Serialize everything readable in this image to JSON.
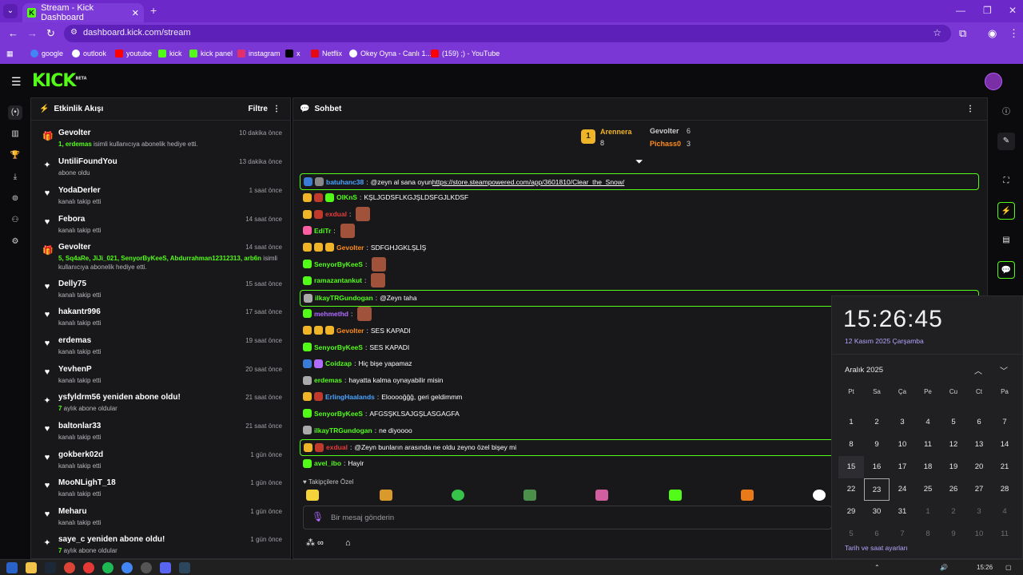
{
  "browser": {
    "tab_title": "Stream - Kick Dashboard",
    "url": "dashboard.kick.com/stream",
    "bookmarks": [
      {
        "label": "google",
        "color": "#4285f4"
      },
      {
        "label": "outlook",
        "color": "#ffffff"
      },
      {
        "label": "youtube",
        "color": "#ff0000"
      },
      {
        "label": "kick",
        "color": "#53fc18"
      },
      {
        "label": "kick panel",
        "color": "#53fc18"
      },
      {
        "label": "instagram",
        "color": "#e1306c"
      },
      {
        "label": "x",
        "color": "#000000"
      },
      {
        "label": "Netflix",
        "color": "#e50914"
      },
      {
        "label": "Okey Oyna - Canlı 1...",
        "color": "#ffffff"
      },
      {
        "label": "(159) ;) - YouTube",
        "color": "#ff0000"
      }
    ]
  },
  "header": {
    "logo": "KICK",
    "beta": "BETA"
  },
  "activity": {
    "title": "Etkinlik Akışı",
    "filter": "Filtre",
    "events": [
      {
        "icon": "gift-icon",
        "name": "Gevolter",
        "time": "10 dakika önce",
        "desc_hl": "1, erdemas",
        "desc": " isimli kullanıcıya abonelik hediye etti.",
        "color": "#53fc18"
      },
      {
        "icon": "sparkle-icon",
        "name": "UntiliFoundYou",
        "time": "13 dakika önce",
        "desc_hl": "",
        "desc": "abone oldu",
        "color": "#ffffff"
      },
      {
        "icon": "heart-icon",
        "name": "YodaDerler",
        "time": "1 saat önce",
        "desc_hl": "",
        "desc": "kanalı takip etti",
        "color": "#ffffff"
      },
      {
        "icon": "heart-icon",
        "name": "Febora",
        "time": "14 saat önce",
        "desc_hl": "",
        "desc": "kanalı takip etti",
        "color": "#ffffff"
      },
      {
        "icon": "gift-icon",
        "name": "Gevolter",
        "time": "14 saat önce",
        "desc_hl": "5, Sq4aRe, JiJi_021, SenyorByKeeS, Abdurrahman12312313, arb6n",
        "desc": " isimli kullanıcıya abonelik hediye etti.",
        "color": "#53fc18"
      },
      {
        "icon": "heart-icon",
        "name": "Delly75",
        "time": "15 saat önce",
        "desc_hl": "",
        "desc": "kanalı takip etti",
        "color": "#ffffff"
      },
      {
        "icon": "heart-icon",
        "name": "hakantr996",
        "time": "17 saat önce",
        "desc_hl": "",
        "desc": "kanalı takip etti",
        "color": "#ffffff"
      },
      {
        "icon": "heart-icon",
        "name": "erdemas",
        "time": "19 saat önce",
        "desc_hl": "",
        "desc": "kanalı takip etti",
        "color": "#ffffff"
      },
      {
        "icon": "heart-icon",
        "name": "YevhenP",
        "time": "20 saat önce",
        "desc_hl": "",
        "desc": "kanalı takip etti",
        "color": "#ffffff"
      },
      {
        "icon": "sparkle-icon",
        "name": "ysfyldrm56 yeniden abone oldu!",
        "time": "21 saat önce",
        "desc_hl": "7",
        "desc": " aylık abone oldular",
        "color": "#ffffff"
      },
      {
        "icon": "heart-icon",
        "name": "baltonlar33",
        "time": "21 saat önce",
        "desc_hl": "",
        "desc": "kanalı takip etti",
        "color": "#ffffff"
      },
      {
        "icon": "heart-icon",
        "name": "gokberk02d",
        "time": "1 gün önce",
        "desc_hl": "",
        "desc": "kanalı takip etti",
        "color": "#ffffff"
      },
      {
        "icon": "heart-icon",
        "name": "MooNLighT_18",
        "time": "1 gün önce",
        "desc_hl": "",
        "desc": "kanalı takip etti",
        "color": "#ffffff"
      },
      {
        "icon": "heart-icon",
        "name": "Meharu",
        "time": "1 gün önce",
        "desc_hl": "",
        "desc": "kanalı takip etti",
        "color": "#ffffff"
      },
      {
        "icon": "sparkle-icon",
        "name": "saye_c yeniden abone oldu!",
        "time": "1 gün önce",
        "desc_hl": "7",
        "desc": " aylık abone oldular",
        "color": "#ffffff"
      }
    ]
  },
  "chat": {
    "title": "Sohbet",
    "podium": {
      "first": "Arennera",
      "first_count": "8",
      "second": "Gevolter",
      "second_count": "6",
      "third": "Pichass0",
      "third_count": "3",
      "first_rank": "1"
    },
    "messages": [
      {
        "user": "batuhanc38",
        "color": "#4aa3ff",
        "text": "@zeyn al sana oyun ",
        "link": "https://store.steampowered.com/app/3601810/Clear_the_Snow/",
        "hl": true,
        "badges": [
          "#3a7bd5",
          "#888"
        ],
        "emote": false
      },
      {
        "user": "OlKnS",
        "color": "#53fc18",
        "text": "KŞLJGDSFLKGJŞLDSFGJLKDSF",
        "hl": false,
        "badges": [
          "#f0b429",
          "#c0392b",
          "#53fc18"
        ],
        "emote": false
      },
      {
        "user": "exdual",
        "color": "#e83b3b",
        "text": "",
        "hl": false,
        "badges": [
          "#f0b429",
          "#c0392b"
        ],
        "emote": true
      },
      {
        "user": "EdiTr",
        "color": "#53fc18",
        "text": "",
        "hl": false,
        "badges": [
          "#ff5fa2"
        ],
        "emote": true
      },
      {
        "user": "Gevolter",
        "color": "#ff8c1a",
        "text": "SDFGHJGKLŞLİŞ",
        "hl": false,
        "badges": [
          "#f0b429",
          "#f0b429",
          "#f0b429"
        ],
        "emote": false
      },
      {
        "user": "SenyorByKeeS",
        "color": "#53fc18",
        "text": "",
        "hl": false,
        "badges": [
          "#53fc18"
        ],
        "emote": true
      },
      {
        "user": "ramazantankut",
        "color": "#53fc18",
        "text": "",
        "hl": false,
        "badges": [
          "#53fc18"
        ],
        "emote": true
      },
      {
        "user": "ilkayTRGundogan",
        "color": "#53fc18",
        "text": "@Zeyn taha",
        "hl": true,
        "badges": [
          "#aaa"
        ],
        "emote": false
      },
      {
        "user": "mehmethd",
        "color": "#b06bff",
        "text": "",
        "hl": false,
        "badges": [
          "#53fc18"
        ],
        "emote": true
      },
      {
        "user": "Gevolter",
        "color": "#ff8c1a",
        "text": "SES KAPADI",
        "hl": false,
        "badges": [
          "#f0b429",
          "#f0b429",
          "#f0b429"
        ],
        "emote": false
      },
      {
        "user": "SenyorByKeeS",
        "color": "#53fc18",
        "text": "SES KAPADI",
        "hl": false,
        "badges": [
          "#53fc18"
        ],
        "emote": false
      },
      {
        "user": "Coidzap",
        "color": "#53fc18",
        "text": "Hiç bişe yapamaz",
        "hl": false,
        "badges": [
          "#3a7bd5",
          "#b06bff"
        ],
        "emote": false
      },
      {
        "user": "erdemas",
        "color": "#53fc18",
        "text": "hayatta kalma oynayabilir misin",
        "hl": false,
        "badges": [
          "#aaa"
        ],
        "emote": false
      },
      {
        "user": "ErlingHaalands",
        "color": "#4aa3ff",
        "text": "Eloooоğğğ, geri geldimmm",
        "hl": false,
        "badges": [
          "#f0b429",
          "#c0392b"
        ],
        "emote": false
      },
      {
        "user": "SenyorByKeeS",
        "color": "#53fc18",
        "text": "AFGSŞKLSAJGŞLASGAGFA",
        "hl": false,
        "badges": [
          "#53fc18"
        ],
        "emote": false
      },
      {
        "user": "ilkayTRGundogan",
        "color": "#53fc18",
        "text": "ne diyoooo",
        "hl": false,
        "badges": [
          "#aaa"
        ],
        "emote": false
      },
      {
        "user": "exdual",
        "color": "#e83b3b",
        "text": "@Zeyn bunların arasında ne oldu zeyno özel bişey mi",
        "hl": true,
        "badges": [
          "#f0b429",
          "#c0392b"
        ],
        "emote": false
      },
      {
        "user": "avel_ibo",
        "color": "#53fc18",
        "text": "Hayir",
        "hl": false,
        "badges": [
          "#53fc18"
        ],
        "emote": false
      }
    ],
    "followers_label": "Takipçilere Özel",
    "input_placeholder": "Bir mesaj gönderin"
  },
  "calendar": {
    "time": "15:26:45",
    "date": "12 Kasım 2025 Çarşamba",
    "month": "Aralık 2025",
    "weekdays": [
      "Pt",
      "Sa",
      "Ça",
      "Pe",
      "Cu",
      "Ct",
      "Pa"
    ],
    "weeks": [
      [
        {
          "d": "1"
        },
        {
          "d": "2"
        },
        {
          "d": "3"
        },
        {
          "d": "4"
        },
        {
          "d": "5"
        },
        {
          "d": "6"
        },
        {
          "d": "7"
        }
      ],
      [
        {
          "d": "8"
        },
        {
          "d": "9"
        },
        {
          "d": "10"
        },
        {
          "d": "11"
        },
        {
          "d": "12"
        },
        {
          "d": "13"
        },
        {
          "d": "14"
        }
      ],
      [
        {
          "d": "15"
        },
        {
          "d": "16"
        },
        {
          "d": "17"
        },
        {
          "d": "18"
        },
        {
          "d": "19"
        },
        {
          "d": "20"
        },
        {
          "d": "21"
        }
      ],
      [
        {
          "d": "22"
        },
        {
          "d": "23"
        },
        {
          "d": "24"
        },
        {
          "d": "25"
        },
        {
          "d": "26"
        },
        {
          "d": "27"
        },
        {
          "d": "28"
        }
      ],
      [
        {
          "d": "29"
        },
        {
          "d": "30"
        },
        {
          "d": "31"
        },
        {
          "d": "1",
          "dim": true
        },
        {
          "d": "2",
          "dim": true
        },
        {
          "d": "3",
          "dim": true
        },
        {
          "d": "4",
          "dim": true
        }
      ],
      [
        {
          "d": "5",
          "dim": true
        },
        {
          "d": "6",
          "dim": true
        },
        {
          "d": "7",
          "dim": true
        },
        {
          "d": "8",
          "dim": true
        },
        {
          "d": "9",
          "dim": true
        },
        {
          "d": "10",
          "dim": true
        },
        {
          "d": "11",
          "dim": true
        }
      ]
    ],
    "settings_link": "Tarih ve saat ayarları"
  },
  "taskbar": {
    "time": "15:26"
  }
}
